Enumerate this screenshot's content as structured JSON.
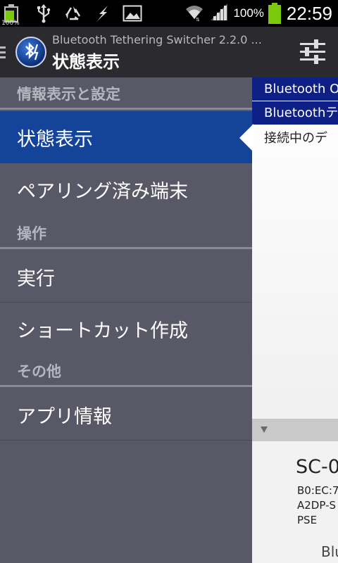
{
  "status_bar": {
    "small_battery_pct": "100%",
    "battery_pct": "100%",
    "time": "22:59",
    "icons": [
      "battery-icon",
      "usb-icon",
      "recycle-icon",
      "flash-icon",
      "image-icon",
      "wifi-icon",
      "signal-icon",
      "battery-icon"
    ]
  },
  "action_bar": {
    "subtitle": "Bluetooth Tethering Switcher 2.2.0 ...",
    "title": "状態表示",
    "icons": [
      "drawer-indicator-icon",
      "bluetooth-app-icon",
      "settings-sliders-icon"
    ]
  },
  "drawer": {
    "sections": [
      {
        "header": "情報表示と設定",
        "items": [
          "状態表示",
          "ペアリング済み端末"
        ]
      },
      {
        "header": "操作",
        "items": [
          "実行",
          "ショートカット作成"
        ]
      },
      {
        "header": "その他",
        "items": [
          "アプリ情報"
        ]
      }
    ],
    "selected_item": "状態表示"
  },
  "content": {
    "banner1": "Bluetooth O",
    "banner2": "Bluetoothテ",
    "line1": "接続中のデ",
    "device_name": "SC-0",
    "detail1": "B0:EC:7",
    "detail2": "A2DP-S",
    "detail3": "PSE",
    "bottom_text": "Blu"
  },
  "colors": {
    "drawer_bg": "#585866",
    "selected_bg": "#13449a",
    "action_bar_bg": "#2b2b2f",
    "banner_bg": "#0e1f86",
    "battery_green": "#7ac90a"
  }
}
